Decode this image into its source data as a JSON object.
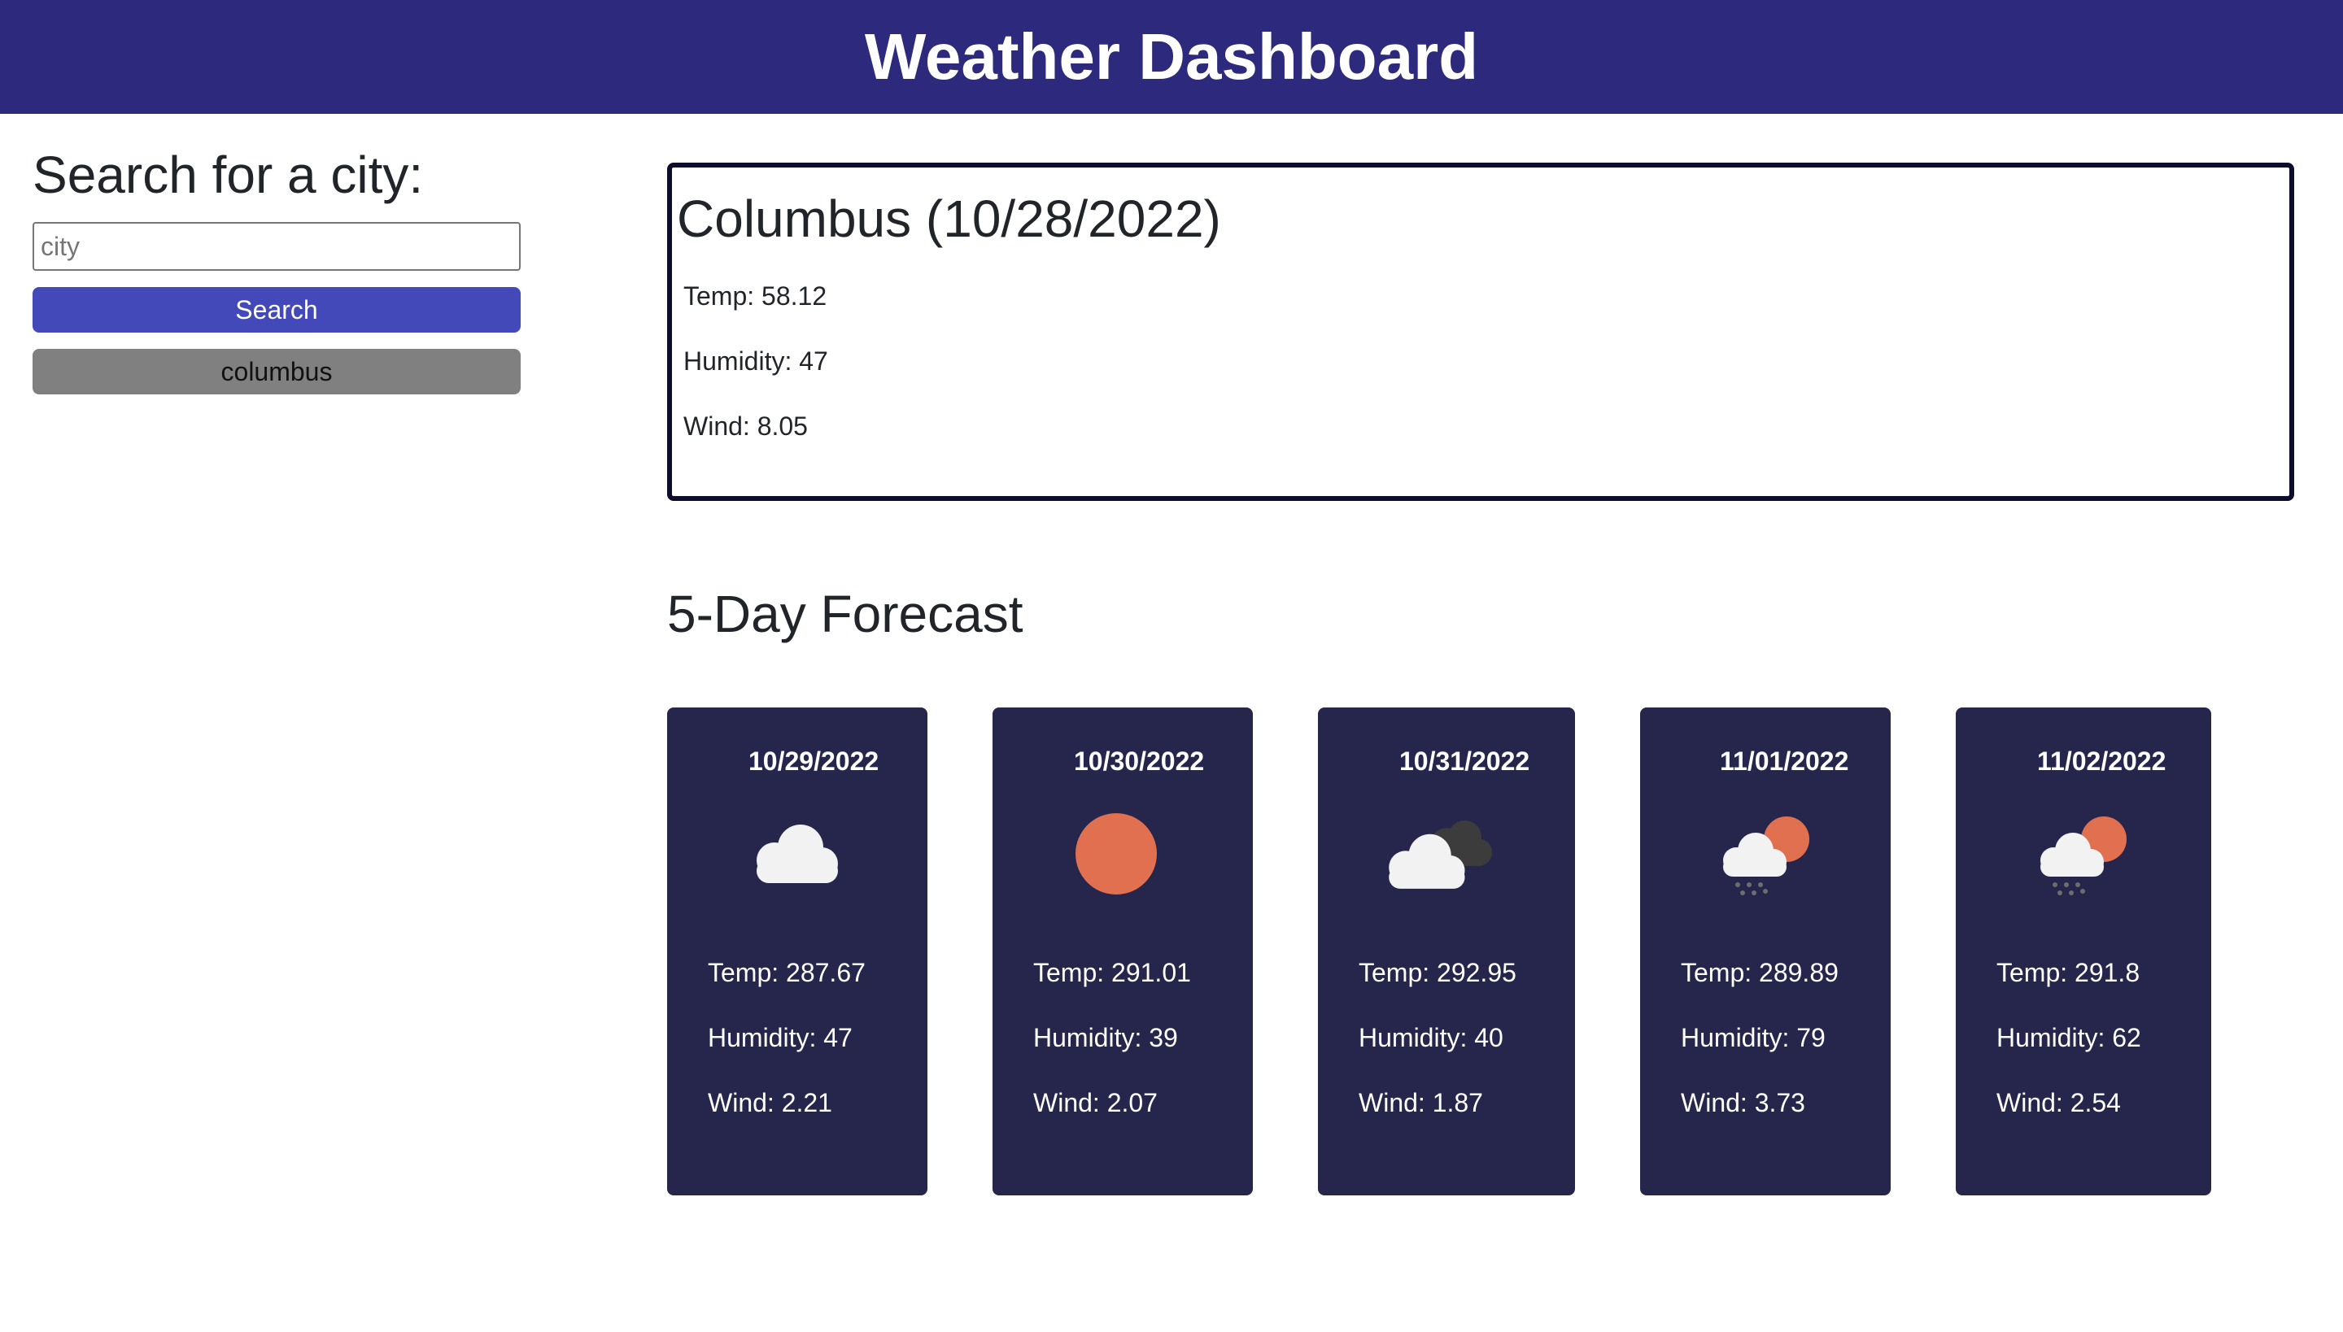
{
  "header": {
    "title": "Weather Dashboard"
  },
  "sidebar": {
    "search_title": "Search for a city:",
    "search_placeholder": "city",
    "search_value": "",
    "search_button": "Search",
    "history": [
      "columbus"
    ]
  },
  "current": {
    "title": "Columbus (10/28/2022)",
    "temp": "Temp: 58.12",
    "humidity": "Humidity: 47",
    "wind": "Wind: 8.05"
  },
  "forecast": {
    "title": "5-Day Forecast",
    "days": [
      {
        "date": "10/29/2022",
        "icon": "cloud-icon",
        "temp": "Temp: 287.67",
        "humidity": "Humidity: 47",
        "wind": "Wind: 2.21"
      },
      {
        "date": "10/30/2022",
        "icon": "sun-icon",
        "temp": "Temp: 291.01",
        "humidity": "Humidity: 39",
        "wind": "Wind: 2.07"
      },
      {
        "date": "10/31/2022",
        "icon": "broken-clouds-icon",
        "temp": "Temp: 292.95",
        "humidity": "Humidity: 40",
        "wind": "Wind: 1.87"
      },
      {
        "date": "11/01/2022",
        "icon": "rain-sun-icon",
        "temp": "Temp: 289.89",
        "humidity": "Humidity: 79",
        "wind": "Wind: 3.73"
      },
      {
        "date": "11/02/2022",
        "icon": "rain-sun-icon",
        "temp": "Temp: 291.8",
        "humidity": "Humidity: 62",
        "wind": "Wind: 2.54"
      }
    ]
  },
  "colors": {
    "header_bg": "#2d2a7d",
    "search_button": "#4349b9",
    "history_button": "#808080",
    "card_bg": "#26264c",
    "sun": "#e07050"
  }
}
